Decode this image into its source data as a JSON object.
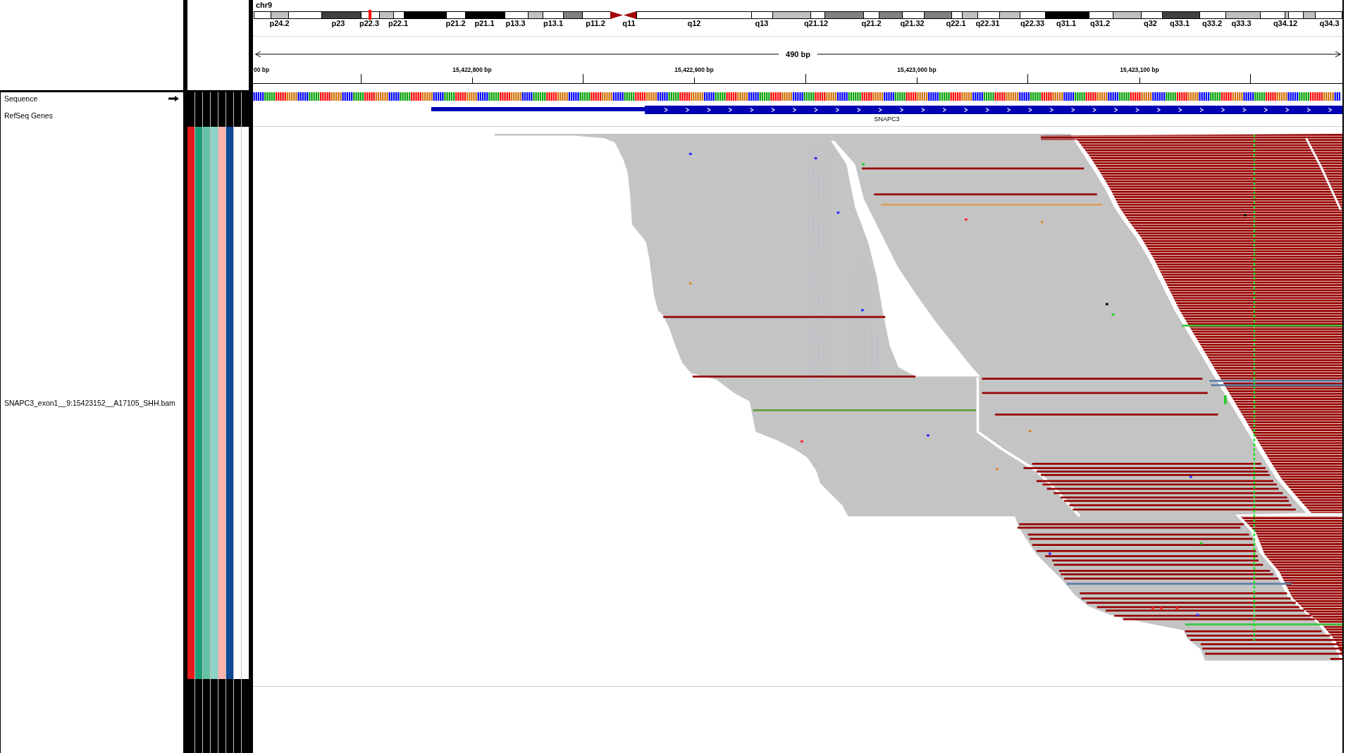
{
  "ideogram": {
    "chromosome": "chr9",
    "band_labels": [
      "p24.2",
      "p23",
      "p22.3",
      "p22.1",
      "p21.2",
      "p21.1",
      "p13.3",
      "p13.1",
      "p11.2",
      "q11",
      "q12",
      "q13",
      "q21.12",
      "q21.2",
      "q21.32",
      "q22.1",
      "q22.31",
      "q22.33",
      "q31.1",
      "q31.2",
      "q32",
      "q33.1",
      "q33.2",
      "q33.3",
      "q34.12",
      "q34.3"
    ]
  },
  "ruler": {
    "span": "490 bp",
    "tick_labels": [
      "00 bp",
      "15,422,800 bp",
      "15,422,900 bp",
      "15,423,000 bp",
      "15,423,100 bp"
    ]
  },
  "tracks": [
    {
      "kind": "sequence",
      "name": "Sequence",
      "forward_strand": true
    },
    {
      "kind": "genes",
      "name": "RefSeq Genes",
      "features": [
        {
          "name": "SNAPC3",
          "forward_strand": true
        }
      ]
    },
    {
      "kind": "alignment",
      "name": "SNAPC3_exon1__9:15423152__A17105_SHH.bam",
      "attributes": [
        {
          "color": "#e41a1c"
        },
        {
          "color": "#1b9e77"
        },
        {
          "color": "#66c2a5"
        },
        {
          "color": "#8dd3c7"
        },
        {
          "color": "#fbb4ae"
        },
        {
          "color": "#0c4a96"
        },
        {
          "color": "#ffffff"
        },
        {
          "color": "#ffffff"
        }
      ]
    }
  ]
}
